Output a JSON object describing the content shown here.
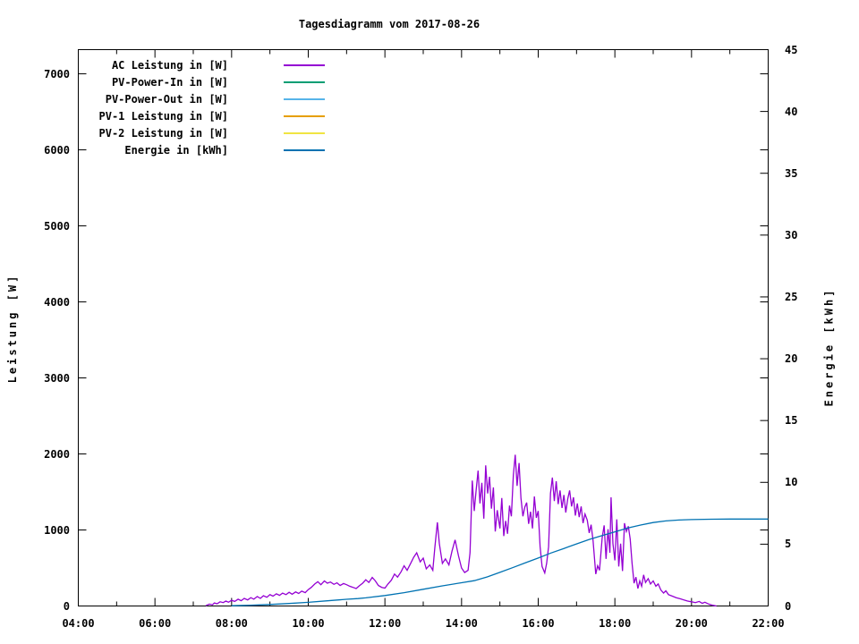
{
  "chart_data": {
    "type": "line",
    "title": "Tagesdiagramm vom 2017-08-26",
    "x_axis": {
      "range": [
        4,
        22
      ],
      "ticks": [
        {
          "v": 4,
          "t": "04:00"
        },
        {
          "v": 6,
          "t": "06:00"
        },
        {
          "v": 8,
          "t": "08:00"
        },
        {
          "v": 10,
          "t": "10:00"
        },
        {
          "v": 12,
          "t": "12:00"
        },
        {
          "v": 14,
          "t": "14:00"
        },
        {
          "v": 16,
          "t": "16:00"
        },
        {
          "v": 18,
          "t": "18:00"
        },
        {
          "v": 20,
          "t": "20:00"
        },
        {
          "v": 22,
          "t": "22:00"
        }
      ],
      "minor": [
        5,
        7,
        9,
        11,
        13,
        15,
        17,
        19,
        21
      ]
    },
    "y_left": {
      "label": "Leistung [W]",
      "range": [
        0,
        7318
      ],
      "ticks": [
        {
          "v": 0,
          "t": "0"
        },
        {
          "v": 1000,
          "t": "1000"
        },
        {
          "v": 2000,
          "t": "2000"
        },
        {
          "v": 3000,
          "t": "3000"
        },
        {
          "v": 4000,
          "t": "4000"
        },
        {
          "v": 5000,
          "t": "5000"
        },
        {
          "v": 6000,
          "t": "6000"
        },
        {
          "v": 7000,
          "t": "7000"
        }
      ]
    },
    "y_right": {
      "label": "Energie [kWh]",
      "range": [
        0,
        45
      ],
      "ticks": [
        {
          "v": 0,
          "t": "0"
        },
        {
          "v": 5,
          "t": "5"
        },
        {
          "v": 10,
          "t": "10"
        },
        {
          "v": 15,
          "t": "15"
        },
        {
          "v": 20,
          "t": "20"
        },
        {
          "v": 25,
          "t": "25"
        },
        {
          "v": 30,
          "t": "30"
        },
        {
          "v": 35,
          "t": "35"
        },
        {
          "v": 40,
          "t": "40"
        },
        {
          "v": 45,
          "t": "45"
        }
      ]
    },
    "series": [
      {
        "name": "AC Leistung in [W]",
        "color": "#9400d3",
        "axis": "left",
        "points": [
          [
            7.33,
            5
          ],
          [
            7.42,
            25
          ],
          [
            7.5,
            15
          ],
          [
            7.55,
            40
          ],
          [
            7.62,
            30
          ],
          [
            7.7,
            55
          ],
          [
            7.78,
            45
          ],
          [
            7.85,
            65
          ],
          [
            7.92,
            50
          ],
          [
            8.0,
            75
          ],
          [
            8.08,
            60
          ],
          [
            8.17,
            90
          ],
          [
            8.25,
            70
          ],
          [
            8.33,
            100
          ],
          [
            8.42,
            80
          ],
          [
            8.5,
            110
          ],
          [
            8.58,
            90
          ],
          [
            8.67,
            125
          ],
          [
            8.75,
            100
          ],
          [
            8.83,
            135
          ],
          [
            8.92,
            115
          ],
          [
            9.0,
            150
          ],
          [
            9.08,
            130
          ],
          [
            9.17,
            160
          ],
          [
            9.25,
            140
          ],
          [
            9.33,
            170
          ],
          [
            9.42,
            150
          ],
          [
            9.5,
            180
          ],
          [
            9.58,
            155
          ],
          [
            9.67,
            185
          ],
          [
            9.75,
            165
          ],
          [
            9.83,
            195
          ],
          [
            9.92,
            175
          ],
          [
            10.0,
            215
          ],
          [
            10.08,
            245
          ],
          [
            10.17,
            290
          ],
          [
            10.25,
            320
          ],
          [
            10.33,
            280
          ],
          [
            10.42,
            330
          ],
          [
            10.5,
            300
          ],
          [
            10.58,
            315
          ],
          [
            10.67,
            285
          ],
          [
            10.75,
            305
          ],
          [
            10.83,
            270
          ],
          [
            10.92,
            295
          ],
          [
            11.0,
            280
          ],
          [
            11.08,
            260
          ],
          [
            11.17,
            245
          ],
          [
            11.25,
            230
          ],
          [
            11.33,
            265
          ],
          [
            11.42,
            300
          ],
          [
            11.5,
            345
          ],
          [
            11.58,
            310
          ],
          [
            11.67,
            375
          ],
          [
            11.75,
            330
          ],
          [
            11.83,
            270
          ],
          [
            11.92,
            245
          ],
          [
            12.0,
            235
          ],
          [
            12.08,
            290
          ],
          [
            12.17,
            340
          ],
          [
            12.25,
            420
          ],
          [
            12.33,
            380
          ],
          [
            12.42,
            450
          ],
          [
            12.5,
            530
          ],
          [
            12.58,
            470
          ],
          [
            12.67,
            560
          ],
          [
            12.75,
            640
          ],
          [
            12.83,
            700
          ],
          [
            12.92,
            580
          ],
          [
            13.0,
            630
          ],
          [
            13.08,
            490
          ],
          [
            13.17,
            540
          ],
          [
            13.25,
            470
          ],
          [
            13.3,
            760
          ],
          [
            13.37,
            1100
          ],
          [
            13.42,
            820
          ],
          [
            13.5,
            560
          ],
          [
            13.58,
            620
          ],
          [
            13.67,
            540
          ],
          [
            13.75,
            720
          ],
          [
            13.83,
            870
          ],
          [
            13.92,
            660
          ],
          [
            14.0,
            500
          ],
          [
            14.08,
            440
          ],
          [
            14.17,
            470
          ],
          [
            14.22,
            700
          ],
          [
            14.28,
            1650
          ],
          [
            14.33,
            1250
          ],
          [
            14.38,
            1520
          ],
          [
            14.43,
            1780
          ],
          [
            14.48,
            1350
          ],
          [
            14.53,
            1620
          ],
          [
            14.58,
            1150
          ],
          [
            14.63,
            1850
          ],
          [
            14.68,
            1480
          ],
          [
            14.73,
            1700
          ],
          [
            14.78,
            1280
          ],
          [
            14.83,
            1560
          ],
          [
            14.88,
            980
          ],
          [
            14.93,
            1260
          ],
          [
            15.0,
            1020
          ],
          [
            15.05,
            1420
          ],
          [
            15.1,
            920
          ],
          [
            15.15,
            1120
          ],
          [
            15.2,
            950
          ],
          [
            15.25,
            1320
          ],
          [
            15.3,
            1180
          ],
          [
            15.35,
            1720
          ],
          [
            15.4,
            1990
          ],
          [
            15.45,
            1580
          ],
          [
            15.5,
            1880
          ],
          [
            15.55,
            1420
          ],
          [
            15.6,
            1180
          ],
          [
            15.65,
            1300
          ],
          [
            15.7,
            1360
          ],
          [
            15.75,
            1080
          ],
          [
            15.8,
            1240
          ],
          [
            15.85,
            1020
          ],
          [
            15.9,
            1440
          ],
          [
            15.95,
            1160
          ],
          [
            16.0,
            1250
          ],
          [
            16.05,
            780
          ],
          [
            16.1,
            520
          ],
          [
            16.17,
            435
          ],
          [
            16.22,
            560
          ],
          [
            16.27,
            780
          ],
          [
            16.32,
            1480
          ],
          [
            16.37,
            1690
          ],
          [
            16.42,
            1380
          ],
          [
            16.47,
            1640
          ],
          [
            16.52,
            1340
          ],
          [
            16.57,
            1520
          ],
          [
            16.62,
            1290
          ],
          [
            16.67,
            1460
          ],
          [
            16.72,
            1230
          ],
          [
            16.77,
            1410
          ],
          [
            16.82,
            1520
          ],
          [
            16.87,
            1310
          ],
          [
            16.92,
            1430
          ],
          [
            16.97,
            1190
          ],
          [
            17.02,
            1350
          ],
          [
            17.07,
            1170
          ],
          [
            17.12,
            1310
          ],
          [
            17.17,
            1090
          ],
          [
            17.22,
            1210
          ],
          [
            17.28,
            1130
          ],
          [
            17.33,
            960
          ],
          [
            17.38,
            1070
          ],
          [
            17.43,
            860
          ],
          [
            17.5,
            420
          ],
          [
            17.55,
            530
          ],
          [
            17.6,
            470
          ],
          [
            17.67,
            900
          ],
          [
            17.72,
            1060
          ],
          [
            17.77,
            620
          ],
          [
            17.82,
            1010
          ],
          [
            17.87,
            700
          ],
          [
            17.9,
            1430
          ],
          [
            17.95,
            820
          ],
          [
            18.0,
            600
          ],
          [
            18.05,
            1140
          ],
          [
            18.1,
            520
          ],
          [
            18.15,
            820
          ],
          [
            18.2,
            460
          ],
          [
            18.25,
            1090
          ],
          [
            18.3,
            980
          ],
          [
            18.35,
            1050
          ],
          [
            18.4,
            880
          ],
          [
            18.45,
            560
          ],
          [
            18.5,
            300
          ],
          [
            18.55,
            380
          ],
          [
            18.6,
            230
          ],
          [
            18.65,
            330
          ],
          [
            18.7,
            260
          ],
          [
            18.75,
            410
          ],
          [
            18.8,
            310
          ],
          [
            18.87,
            360
          ],
          [
            18.93,
            290
          ],
          [
            19.0,
            330
          ],
          [
            19.07,
            260
          ],
          [
            19.13,
            290
          ],
          [
            19.2,
            210
          ],
          [
            19.27,
            170
          ],
          [
            19.33,
            200
          ],
          [
            19.4,
            150
          ],
          [
            19.5,
            130
          ],
          [
            19.6,
            110
          ],
          [
            19.7,
            95
          ],
          [
            19.8,
            80
          ],
          [
            19.9,
            65
          ],
          [
            20.0,
            55
          ],
          [
            20.1,
            45
          ],
          [
            20.2,
            60
          ],
          [
            20.28,
            35
          ],
          [
            20.35,
            50
          ],
          [
            20.45,
            25
          ],
          [
            20.55,
            10
          ],
          [
            20.65,
            0
          ]
        ]
      },
      {
        "name": "PV-Power-In in [W]",
        "color": "#009e73",
        "axis": "left",
        "points": []
      },
      {
        "name": "PV-Power-Out in [W]",
        "color": "#56b4e9",
        "axis": "left",
        "points": []
      },
      {
        "name": "PV-1 Leistung in [W]",
        "color": "#e69f00",
        "axis": "left",
        "points": []
      },
      {
        "name": "PV-2 Leistung in [W]",
        "color": "#f0e442",
        "axis": "left",
        "points": []
      },
      {
        "name": "Energie in [kWh]",
        "color": "#0072b2",
        "axis": "right",
        "points": [
          [
            8.0,
            0.02
          ],
          [
            8.5,
            0.06
          ],
          [
            9.0,
            0.12
          ],
          [
            9.5,
            0.2
          ],
          [
            10.0,
            0.3
          ],
          [
            10.5,
            0.42
          ],
          [
            11.0,
            0.54
          ],
          [
            11.3,
            0.6
          ],
          [
            11.5,
            0.66
          ],
          [
            12.0,
            0.85
          ],
          [
            12.5,
            1.08
          ],
          [
            13.0,
            1.35
          ],
          [
            13.5,
            1.63
          ],
          [
            14.0,
            1.88
          ],
          [
            14.33,
            2.05
          ],
          [
            14.67,
            2.35
          ],
          [
            15.0,
            2.72
          ],
          [
            15.33,
            3.1
          ],
          [
            15.67,
            3.5
          ],
          [
            16.0,
            3.88
          ],
          [
            16.33,
            4.28
          ],
          [
            16.67,
            4.65
          ],
          [
            17.0,
            5.02
          ],
          [
            17.33,
            5.38
          ],
          [
            17.67,
            5.7
          ],
          [
            18.0,
            6.0
          ],
          [
            18.33,
            6.3
          ],
          [
            18.67,
            6.55
          ],
          [
            19.0,
            6.75
          ],
          [
            19.33,
            6.88
          ],
          [
            19.67,
            6.95
          ],
          [
            20.0,
            6.99
          ],
          [
            20.5,
            7.02
          ],
          [
            21.0,
            7.03
          ],
          [
            22.0,
            7.03
          ]
        ]
      }
    ],
    "legend_position": "top-left-inside",
    "grid": false,
    "colors": {
      "background": "#ffffff",
      "axis": "#000000",
      "text": "#000000"
    }
  }
}
